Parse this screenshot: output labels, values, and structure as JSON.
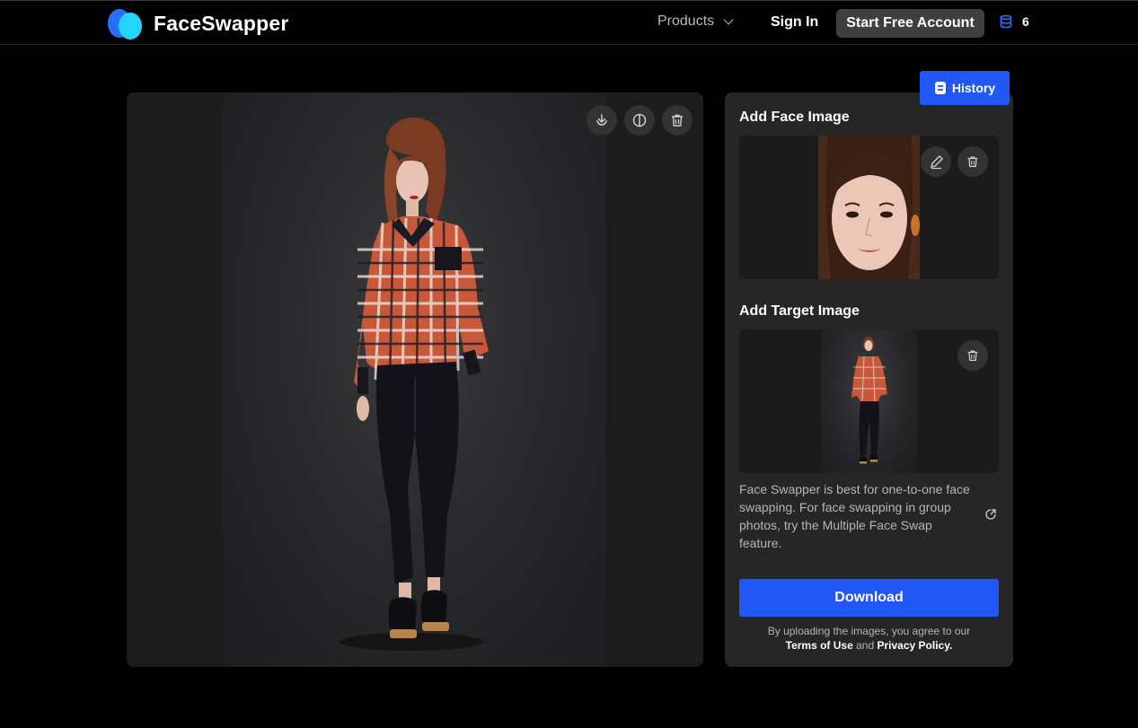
{
  "header": {
    "brand": "FaceSwapper",
    "products_label": "Products",
    "signin_label": "Sign In",
    "start_label": "Start Free Account",
    "credits": "6"
  },
  "preview": {
    "download_icon": "download-icon",
    "compare_icon": "compare-icon",
    "delete_icon": "trash-icon"
  },
  "panel": {
    "history_label": "History",
    "face_title": "Add Face Image",
    "target_title": "Add Target Image",
    "note": "Face Swapper is best for one-to-one face swapping. For face swapping in group photos, try the Multiple Face Swap feature.",
    "download_label": "Download",
    "legal_prefix": "By uploading the images, you agree to our",
    "terms": "Terms of Use",
    "and": "and",
    "privacy": "Privacy Policy."
  },
  "colors": {
    "accent": "#2057f5",
    "logo_blue": "#2a6dff",
    "logo_cyan": "#25d4ff"
  }
}
